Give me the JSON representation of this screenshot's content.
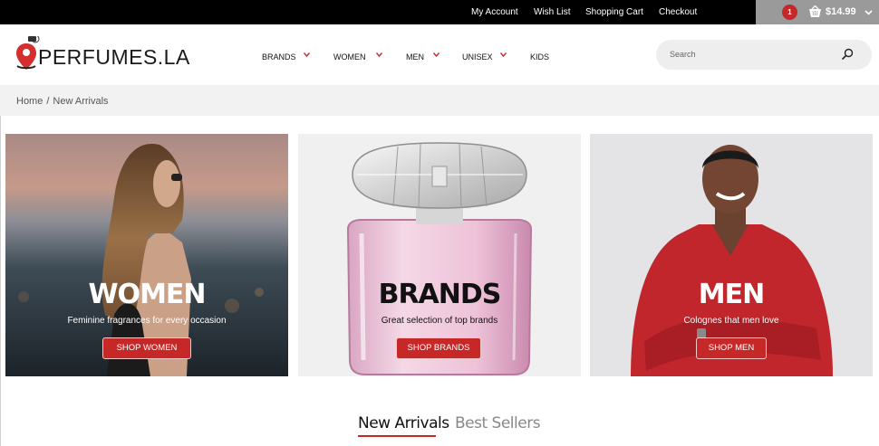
{
  "topbar": {
    "links": [
      "My Account",
      "Wish List",
      "Shopping Cart",
      "Checkout"
    ],
    "cart_count": "1",
    "cart_total": "$14.99"
  },
  "header": {
    "logo_text": "PERFUMES.LA",
    "nav": [
      {
        "label": "BRANDS",
        "has_dropdown": true
      },
      {
        "label": "WOMEN",
        "has_dropdown": true
      },
      {
        "label": "MEN",
        "has_dropdown": true
      },
      {
        "label": "UNISEX",
        "has_dropdown": true
      },
      {
        "label": "KIDS",
        "has_dropdown": false
      }
    ],
    "search_placeholder": "Search"
  },
  "breadcrumb": {
    "home": "Home",
    "separator": "/",
    "current": "New Arrivals"
  },
  "banners": [
    {
      "title": "WOMEN",
      "subtitle": "Feminine fragrances for every occasion",
      "button": "SHOP WOMEN"
    },
    {
      "title": "BRANDS",
      "subtitle": "Great selection of top brands",
      "button": "SHOP BRANDS"
    },
    {
      "title": "MEN",
      "subtitle": "Colognes that men love",
      "button": "SHOP MEN"
    }
  ],
  "tabs": {
    "active": "New Arrivals",
    "inactive": "Best Sellers"
  },
  "colors": {
    "accent": "#c62828",
    "topbar": "#000000",
    "cartbox": "#9a9a9a",
    "crumbbar": "#f2f2f2"
  },
  "icons": [
    "basket-icon",
    "chevron-down-icon",
    "search-icon",
    "location-pin-icon"
  ]
}
